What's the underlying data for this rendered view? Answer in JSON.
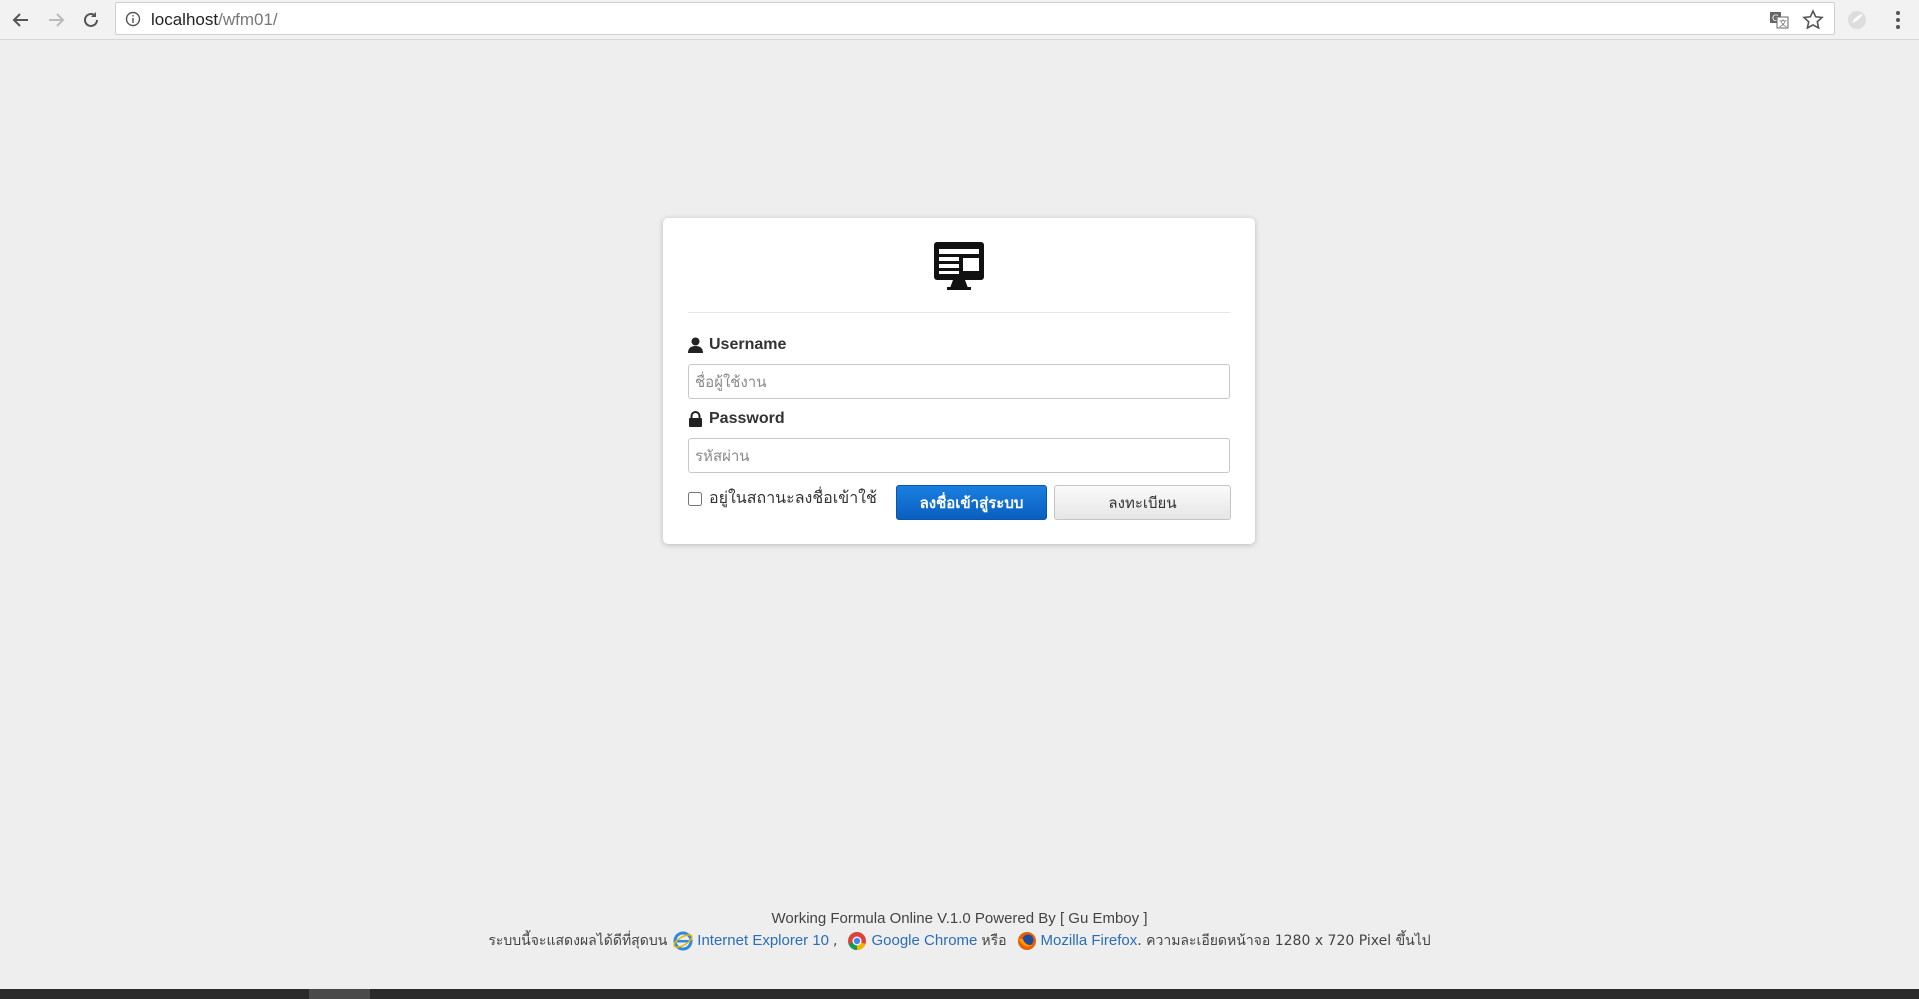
{
  "browser": {
    "url_host": "localhost",
    "url_path": "/wfm01/"
  },
  "login": {
    "username_label": "Username",
    "username_placeholder": "ชื่อผู้ใช้งาน",
    "password_label": "Password",
    "password_placeholder": "รหัสผ่าน",
    "remember_label": "อยู่ในสถานะลงชื่อเข้าใช้",
    "login_button": "ลงชื่อเข้าสู่ระบบ",
    "register_button": "ลงทะเบียน"
  },
  "footer": {
    "line1": "Working Formula Online V.1.0 Powered By [ Gu Emboy ]",
    "prefix": "ระบบนี้จะแสดงผลได้ดีที่สุดบน",
    "browsers": [
      {
        "name": "Internet Explorer 10",
        "icon": "ie-icon"
      },
      {
        "name": "Google Chrome",
        "icon": "chrome-icon"
      },
      {
        "name": "Mozilla Firefox",
        "icon": "firefox-icon"
      }
    ],
    "comma": ",",
    "or": "หรือ",
    "suffix": ". ความละเอียดหน้าจอ 1280 x 720 Pixel ขึ้นไป"
  },
  "colors": {
    "primary_button": "#0a66c8",
    "background": "#eeeeee",
    "link": "#2a6eb8"
  }
}
